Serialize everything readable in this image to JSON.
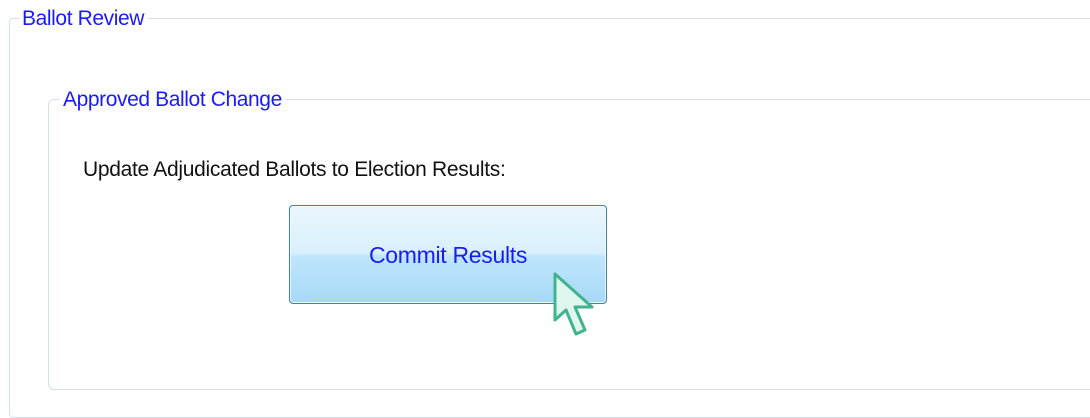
{
  "ballot_review": {
    "title": "Ballot Review",
    "approved_ballot_change": {
      "title": "Approved Ballot Change",
      "instruction": "Update Adjudicated Ballots to Election Results:",
      "commit_button_label": "Commit Results"
    }
  },
  "cursor": {
    "icon": "arrow-pointer-icon",
    "color": "#4fc0a0"
  },
  "colors": {
    "group_title": "#1a1aff",
    "button_border": "#3c7fb1",
    "group_border": "#d5dfe5"
  }
}
